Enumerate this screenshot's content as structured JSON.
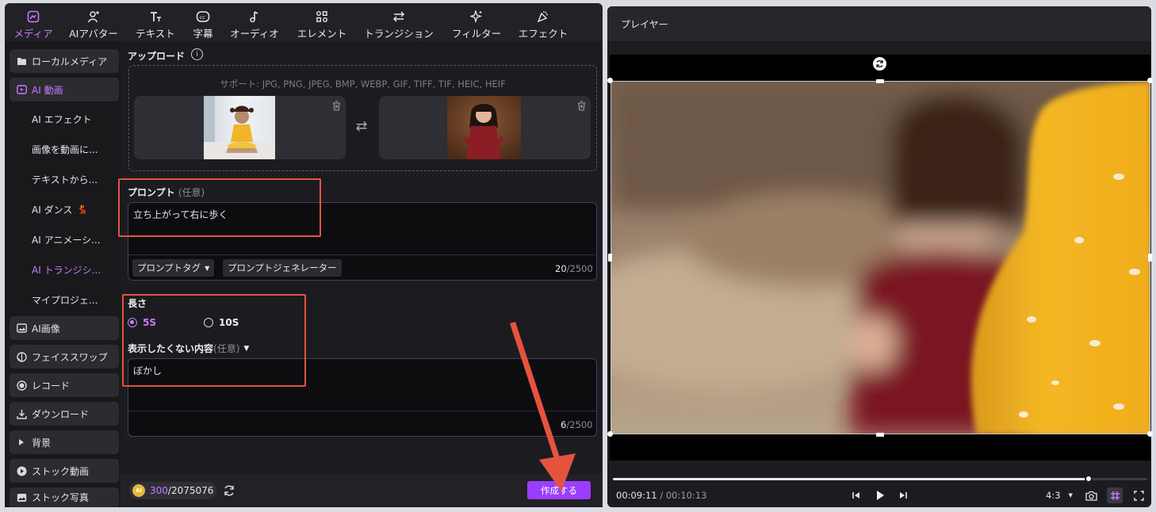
{
  "toolbar": {
    "tabs": [
      {
        "label": "メディア",
        "icon": "media-icon",
        "active": true
      },
      {
        "label": "AIアバター",
        "icon": "avatar-icon"
      },
      {
        "label": "テキスト",
        "icon": "text-icon"
      },
      {
        "label": "字幕",
        "icon": "subtitle-icon"
      },
      {
        "label": "オーディオ",
        "icon": "audio-icon"
      },
      {
        "label": "エレメント",
        "icon": "element-icon"
      },
      {
        "label": "トランジション",
        "icon": "transition-icon"
      },
      {
        "label": "フィルター",
        "icon": "filter-icon"
      },
      {
        "label": "エフェクト",
        "icon": "effect-icon"
      }
    ]
  },
  "sidebar": {
    "items": [
      {
        "label": "ローカルメディア"
      },
      {
        "label": "AI 動画"
      },
      {
        "label": "AI エフェクト"
      },
      {
        "label": "画像を動画に..."
      },
      {
        "label": "テキストから..."
      },
      {
        "label": "AI ダンス"
      },
      {
        "label": "AI アニメーシ..."
      },
      {
        "label": "AI トランジシ..."
      },
      {
        "label": "マイプロジェ..."
      },
      {
        "label": "AI画像"
      },
      {
        "label": "フェイススワップ"
      },
      {
        "label": "レコード"
      },
      {
        "label": "ダウンロード"
      },
      {
        "label": "背景"
      },
      {
        "label": "ストック動画"
      },
      {
        "label": "ストック写真"
      }
    ],
    "dance_emoji": "💃"
  },
  "upload": {
    "title": "アップロード",
    "info_icon": "i",
    "support": "サポート: JPG, PNG, JPEG, BMP, WEBP, GIF, TIFF, TIF, HEIC, HEIF",
    "swap_glyph": "⇄"
  },
  "prompt": {
    "label": "プロンプト",
    "optional": "(任意)",
    "text": "立ち上がって右に歩く",
    "tag_button": "プロンプトタグ",
    "generator_button": "プロンプトジェネレーター",
    "count": "20",
    "max": "/2500"
  },
  "duration": {
    "label": "長さ",
    "options": [
      "5S",
      "10S"
    ],
    "selected": "5S"
  },
  "negative": {
    "label": "表示したくない内容",
    "optional": "(任意)",
    "text": "ぼかし",
    "count": "6",
    "max": "/2500"
  },
  "footer": {
    "coin_label": "AI",
    "credits_used": "300",
    "credits_total": "/2075076",
    "create_button": "作成する"
  },
  "player": {
    "title": "プレイヤー",
    "current_time": "00:09:11",
    "separator": "/",
    "total_time": "00:10:13",
    "progress": 0.89,
    "aspect": "4:3"
  },
  "colors": {
    "accent": "#c67cff",
    "create": "#9b3dff",
    "annotation": "#e5533f"
  }
}
